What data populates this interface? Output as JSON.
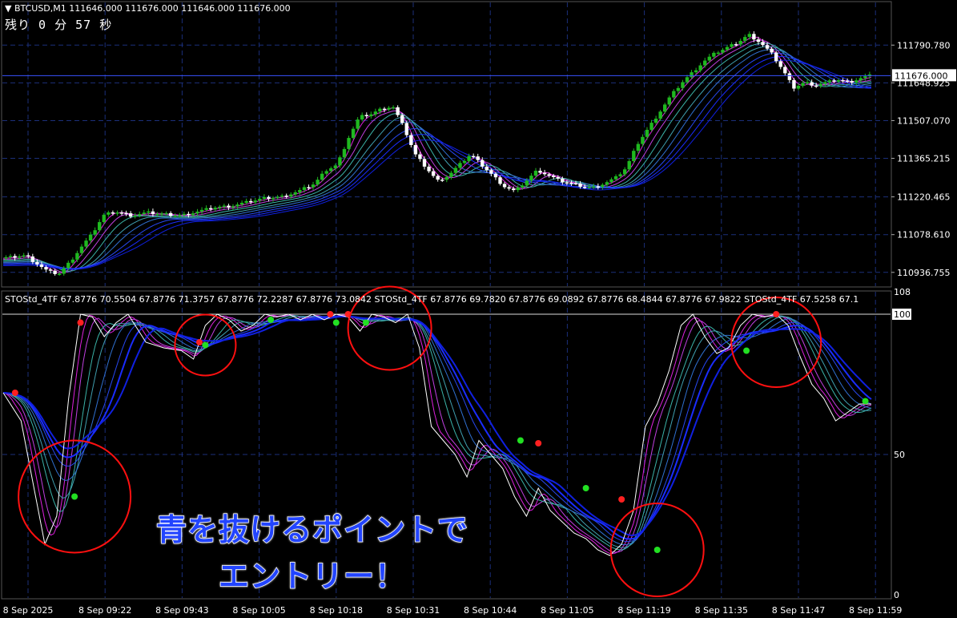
{
  "header": {
    "symbol_line": "BTCUSD,M1  111646.000 111676.000 111646.000 111676.000",
    "countdown": "残り 0 分 57 秒"
  },
  "indicator": {
    "label": "STOStd_4TF 67.8776 70.5504 67.8776 71.3757 67.8776 72.2287 67.8776 73.0842  STOStd_4TF 67.8776 69.7820 67.8776 69.0892 67.8776 68.4844 67.8776 67.9822  STOStd_4TF 67.5258 67.1"
  },
  "caption": {
    "line1": "青を抜けるポイントで",
    "line2": "エントリー！"
  },
  "colors": {
    "bull_candle": "#1fb81f",
    "bear_candle": "#ffffff",
    "grid": "#1b2f7a",
    "ribbon_magenta": "#e020e0",
    "ribbon_teal": "#3bb4a8",
    "ribbon_blue": "#1a2cff",
    "circle": "#ff1010",
    "dot_red": "#ff2020",
    "dot_green": "#22e022",
    "price_line": "#3a52ff"
  },
  "chart_data": [
    {
      "type": "candlestick",
      "symbol": "BTCUSD",
      "timeframe": "M1",
      "current_price": "111676.000",
      "price_ticks": [
        "111790.780",
        "111648.925",
        "111507.070",
        "111365.215",
        "111220.465",
        "111078.610",
        "110936.755"
      ],
      "ylim": [
        110900,
        111900
      ],
      "time_ticks": [
        "8 Sep 2025",
        "8 Sep 09:22",
        "8 Sep 09:43",
        "8 Sep 10:05",
        "8 Sep 10:18",
        "8 Sep 10:31",
        "8 Sep 10:44",
        "8 Sep 11:05",
        "8 Sep 11:19",
        "8 Sep 11:35",
        "8 Sep 11:47",
        "8 Sep 11:59"
      ],
      "price_path": [
        [
          0,
          110990
        ],
        [
          4,
          111000
        ],
        [
          8,
          110940
        ],
        [
          10,
          110930
        ],
        [
          12,
          110975
        ],
        [
          14,
          111030
        ],
        [
          16,
          111080
        ],
        [
          18,
          111150
        ],
        [
          20,
          111165
        ],
        [
          23,
          111150
        ],
        [
          26,
          111160
        ],
        [
          29,
          111155
        ],
        [
          32,
          111150
        ],
        [
          35,
          111165
        ],
        [
          38,
          111180
        ],
        [
          41,
          111185
        ],
        [
          44,
          111200
        ],
        [
          47,
          111215
        ],
        [
          50,
          111220
        ],
        [
          53,
          111240
        ],
        [
          56,
          111270
        ],
        [
          58,
          111320
        ],
        [
          60,
          111340
        ],
        [
          62,
          111440
        ],
        [
          64,
          111520
        ],
        [
          66,
          111530
        ],
        [
          68,
          111550
        ],
        [
          70,
          111560
        ],
        [
          72,
          111480
        ],
        [
          74,
          111380
        ],
        [
          76,
          111330
        ],
        [
          78,
          111280
        ],
        [
          80,
          111300
        ],
        [
          82,
          111340
        ],
        [
          84,
          111380
        ],
        [
          86,
          111340
        ],
        [
          88,
          111300
        ],
        [
          90,
          111260
        ],
        [
          92,
          111240
        ],
        [
          94,
          111280
        ],
        [
          96,
          111320
        ],
        [
          98,
          111300
        ],
        [
          100,
          111280
        ],
        [
          102,
          111270
        ],
        [
          104,
          111260
        ],
        [
          106,
          111255
        ],
        [
          108,
          111270
        ],
        [
          110,
          111290
        ],
        [
          112,
          111330
        ],
        [
          114,
          111420
        ],
        [
          116,
          111480
        ],
        [
          118,
          111540
        ],
        [
          120,
          111600
        ],
        [
          122,
          111650
        ],
        [
          124,
          111690
        ],
        [
          126,
          111730
        ],
        [
          128,
          111760
        ],
        [
          130,
          111780
        ],
        [
          132,
          111800
        ],
        [
          134,
          111830
        ],
        [
          136,
          111800
        ],
        [
          138,
          111760
        ],
        [
          140,
          111700
        ],
        [
          142,
          111630
        ],
        [
          144,
          111650
        ],
        [
          146,
          111640
        ],
        [
          148,
          111650
        ],
        [
          150,
          111660
        ],
        [
          152,
          111650
        ],
        [
          154,
          111665
        ],
        [
          156,
          111676
        ]
      ]
    },
    {
      "type": "line",
      "name": "STOStd_4TF",
      "ylim": [
        0,
        100
      ],
      "y_ticks": [
        "108",
        "100",
        "50",
        "0"
      ],
      "values": [
        [
          0,
          72
        ],
        [
          3,
          62
        ],
        [
          5,
          40
        ],
        [
          7,
          18
        ],
        [
          9,
          28
        ],
        [
          11,
          70
        ],
        [
          13,
          100
        ],
        [
          15,
          99
        ],
        [
          17,
          92
        ],
        [
          19,
          97
        ],
        [
          21,
          100
        ],
        [
          24,
          90
        ],
        [
          27,
          88
        ],
        [
          30,
          87
        ],
        [
          32,
          84
        ],
        [
          34,
          96
        ],
        [
          36,
          100
        ],
        [
          38,
          98
        ],
        [
          40,
          94
        ],
        [
          42,
          96
        ],
        [
          44,
          100
        ],
        [
          46,
          99
        ],
        [
          48,
          100
        ],
        [
          50,
          98
        ],
        [
          52,
          100
        ],
        [
          54,
          98
        ],
        [
          56,
          100
        ],
        [
          58,
          99
        ],
        [
          60,
          94
        ],
        [
          62,
          100
        ],
        [
          64,
          99
        ],
        [
          66,
          97
        ],
        [
          68,
          100
        ],
        [
          70,
          88
        ],
        [
          72,
          60
        ],
        [
          74,
          55
        ],
        [
          76,
          50
        ],
        [
          78,
          42
        ],
        [
          80,
          55
        ],
        [
          82,
          50
        ],
        [
          84,
          45
        ],
        [
          86,
          35
        ],
        [
          88,
          28
        ],
        [
          90,
          38
        ],
        [
          92,
          30
        ],
        [
          94,
          26
        ],
        [
          96,
          22
        ],
        [
          98,
          20
        ],
        [
          100,
          16
        ],
        [
          102,
          14
        ],
        [
          104,
          18
        ],
        [
          106,
          30
        ],
        [
          108,
          60
        ],
        [
          110,
          68
        ],
        [
          112,
          80
        ],
        [
          114,
          96
        ],
        [
          116,
          100
        ],
        [
          118,
          92
        ],
        [
          120,
          86
        ],
        [
          122,
          88
        ],
        [
          124,
          96
        ],
        [
          126,
          100
        ],
        [
          128,
          99
        ],
        [
          130,
          100
        ],
        [
          132,
          96
        ],
        [
          134,
          85
        ],
        [
          136,
          75
        ],
        [
          138,
          70
        ],
        [
          140,
          62
        ],
        [
          142,
          65
        ],
        [
          144,
          68
        ],
        [
          146,
          68
        ]
      ],
      "red_dots": [
        [
          2,
          72
        ],
        [
          13,
          97
        ],
        [
          33,
          90
        ],
        [
          55,
          100
        ],
        [
          58,
          100
        ],
        [
          90,
          54
        ],
        [
          104,
          34
        ],
        [
          130,
          100
        ]
      ],
      "green_dots": [
        [
          12,
          35
        ],
        [
          34,
          89
        ],
        [
          45,
          98
        ],
        [
          56,
          97
        ],
        [
          61,
          97
        ],
        [
          87,
          55
        ],
        [
          98,
          38
        ],
        [
          110,
          16
        ],
        [
          125,
          87
        ],
        [
          145,
          69
        ]
      ],
      "circles": [
        [
          12,
          35
        ],
        [
          34,
          89
        ],
        [
          65,
          95
        ],
        [
          110,
          16
        ],
        [
          130,
          90
        ]
      ]
    }
  ]
}
